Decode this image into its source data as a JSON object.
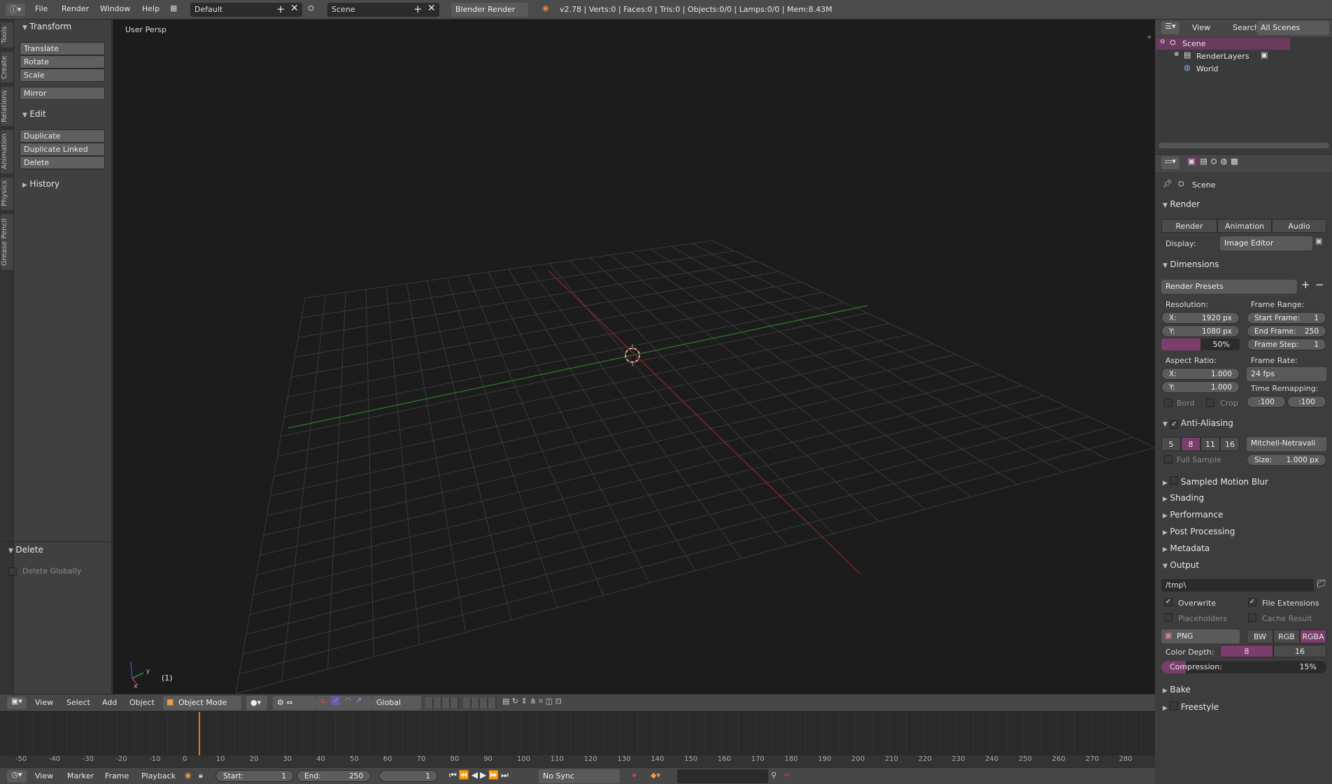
{
  "top_menu": {
    "file": "File",
    "render": "Render",
    "window": "Window",
    "help": "Help"
  },
  "layout": {
    "value": "Default"
  },
  "scene": {
    "value": "Scene"
  },
  "engine": {
    "value": "Blender Render"
  },
  "stats": "v2.78 | Verts:0 | Faces:0 | Tris:0 | Objects:0/0 | Lamps:0/0 | Mem:8.43M",
  "side_tabs": [
    "Tools",
    "Create",
    "Relations",
    "Animation",
    "Physics",
    "Grease Pencil"
  ],
  "toolshelf": {
    "transform_title": "Transform",
    "translate": "Translate",
    "rotate": "Rotate",
    "scale": "Scale",
    "mirror": "Mirror",
    "edit_title": "Edit",
    "duplicate": "Duplicate",
    "duplicate_linked": "Duplicate Linked",
    "delete": "Delete",
    "history_title": "History",
    "op_title": "Delete",
    "delete_globally": "Delete Globally"
  },
  "viewport": {
    "label": "User Persp",
    "frame": "(1)"
  },
  "vp_header": {
    "view": "View",
    "select": "Select",
    "add": "Add",
    "object": "Object",
    "mode": "Object Mode",
    "orientation": "Global"
  },
  "timeline_ticks": [
    "-50",
    "-40",
    "-30",
    "-20",
    "-10",
    "0",
    "10",
    "20",
    "30",
    "40",
    "50",
    "60",
    "70",
    "80",
    "90",
    "100",
    "110",
    "120",
    "130",
    "140",
    "150",
    "160",
    "170",
    "180",
    "190",
    "200",
    "210",
    "220",
    "230",
    "240",
    "250",
    "260",
    "270",
    "280"
  ],
  "tl_header": {
    "view": "View",
    "marker": "Marker",
    "frame": "Frame",
    "playback": "Playback",
    "start_label": "Start:",
    "start": "1",
    "end_label": "End:",
    "end": "250",
    "current": "1",
    "sync": "No Sync"
  },
  "outliner": {
    "view": "View",
    "search": "Search",
    "filter": "All Scenes",
    "scene": "Scene",
    "renderlayers": "RenderLayers",
    "world": "World"
  },
  "properties": {
    "scene": "Scene",
    "render_title": "Render",
    "render_btn": "Render",
    "animation_btn": "Animation",
    "audio_btn": "Audio",
    "display_label": "Display:",
    "display_value": "Image Editor",
    "dimensions_title": "Dimensions",
    "presets": "Render Presets",
    "resolution": "Resolution:",
    "res_x": "X:",
    "res_x_val": "1920 px",
    "res_y": "Y:",
    "res_y_val": "1080 px",
    "res_pct": "50%",
    "frame_range": "Frame Range:",
    "start_frame": "Start Frame:",
    "start_frame_val": "1",
    "end_frame": "End Frame:",
    "end_frame_val": "250",
    "frame_step": "Frame Step:",
    "frame_step_val": "1",
    "aspect": "Aspect Ratio:",
    "asp_x": "X:",
    "asp_x_val": "1.000",
    "asp_y": "Y:",
    "asp_y_val": "1.000",
    "frame_rate": "Frame Rate:",
    "fps": "24 fps",
    "time_remap": "Time Remapping:",
    "remap_old": ":100",
    "remap_new": ":100",
    "bord": "Bord",
    "crop": "Crop",
    "aa_title": "Anti-Aliasing",
    "aa_5": "5",
    "aa_8": "8",
    "aa_11": "11",
    "aa_16": "16",
    "aa_filter": "Mitchell-Netravali",
    "full_sample": "Full Sample",
    "size_label": "Size:",
    "size_val": "1.000 px",
    "smb": "Sampled Motion Blur",
    "shading": "Shading",
    "performance": "Performance",
    "post": "Post Processing",
    "metadata": "Metadata",
    "output": "Output",
    "path": "/tmp\\",
    "overwrite": "Overwrite",
    "file_ext": "File Extensions",
    "placeholders": "Placeholders",
    "cache": "Cache Result",
    "format": "PNG",
    "bw": "BW",
    "rgb": "RGB",
    "rgba": "RGBA",
    "color_depth": "Color Depth:",
    "depth_8": "8",
    "depth_16": "16",
    "compression": "Compression:",
    "compression_val": "15%",
    "bake": "Bake",
    "freestyle": "Freestyle"
  },
  "colors": {
    "accent": "#8a4a7a",
    "selected": "#6b3a5f",
    "x_axis": "#8c2a2a",
    "y_axis": "#2f7a2f",
    "frame_line": "#e07a1f"
  }
}
